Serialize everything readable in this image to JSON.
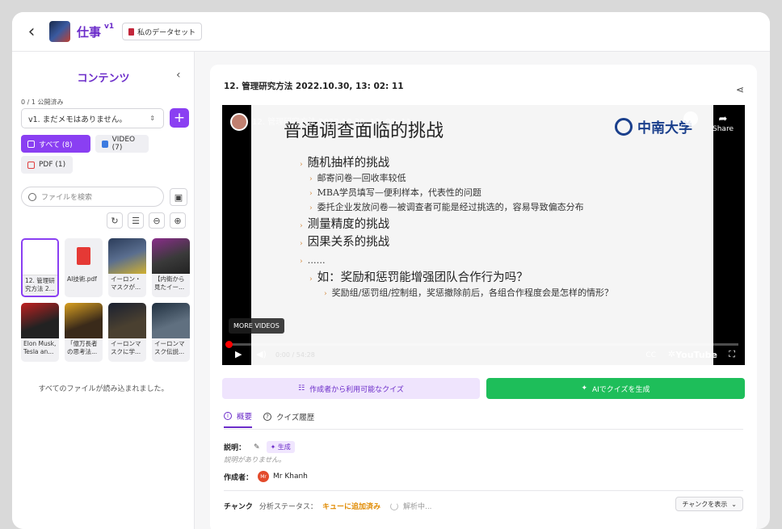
{
  "header": {
    "title": "仕事",
    "version": "v1",
    "dataset_button": "私のデータセット"
  },
  "sidebar": {
    "title": "コンテンツ",
    "published": "0 / 1 公開済み",
    "memo_select": "v1. まだメモはありません。",
    "chips": {
      "all": "すべて (8)",
      "video": "VIDEO (7)",
      "pdf": "PDF (1)"
    },
    "search_placeholder": "ファイルを検索",
    "files": [
      {
        "label": "12. 管理研究方法 2..."
      },
      {
        "label": "AI技術.pdf"
      },
      {
        "label": "イーロン・マスクが..."
      },
      {
        "label": "【内衛から見たイー..."
      },
      {
        "label": "Elon Musk, Tesla an..."
      },
      {
        "label": "「億万長者の思考法..."
      },
      {
        "label": "イーロンマスクに学..."
      },
      {
        "label": "イーロンマスク伝説..."
      }
    ],
    "all_loaded": "すべてのファイルが読み込まれました。"
  },
  "main": {
    "doc_title": "12. 管理研究方法 2022.10.30, 13: 02: 11",
    "video": {
      "overlay_title": "12. 管理研究方法 2022.10.30, 13: 02: 11",
      "share_label": "Share",
      "more_videos": "MORE VIDEOS",
      "time": "0:00 / 54:28",
      "youtube": "YouTube",
      "slide": {
        "title": "普通调查面临的挑战",
        "logo": "中南大学",
        "lines": [
          "随机抽样的挑战",
          "邮寄问卷—回收率较低",
          "MBA学员填写—便利样本，代表性的问题",
          "委托企业发放问卷—被调查者可能是经过挑选的，容易导致偏态分布",
          "测量精度的挑战",
          "因果关系的挑战",
          "……",
          "如：奖励和惩罚能增强团队合作行为吗？",
          "奖励组/惩罚组/控制组，奖惩撤除前后，各组合作程度会是怎样的情形？"
        ]
      }
    },
    "quiz_author": "作成者から利用可能なクイズ",
    "quiz_ai": "AIでクイズを生成",
    "tabs": {
      "overview": "概要",
      "history": "クイズ履歴"
    },
    "desc_label": "説明：",
    "gen_label": "生成",
    "no_desc": "説明がありません。",
    "author_label": "作成者：",
    "author_initials": "Mr",
    "author_name": "Mr Khanh",
    "chunk_label": "チャンク",
    "analysis_status_label": "分析ステータス：",
    "analysis_status": "キューに追加済み",
    "analyzing": "解析中...",
    "show_chunks": "チャンクを表示"
  },
  "colors": {
    "accent": "#8a3ff2",
    "success": "#1ebe5a",
    "queued": "#e08a00"
  }
}
